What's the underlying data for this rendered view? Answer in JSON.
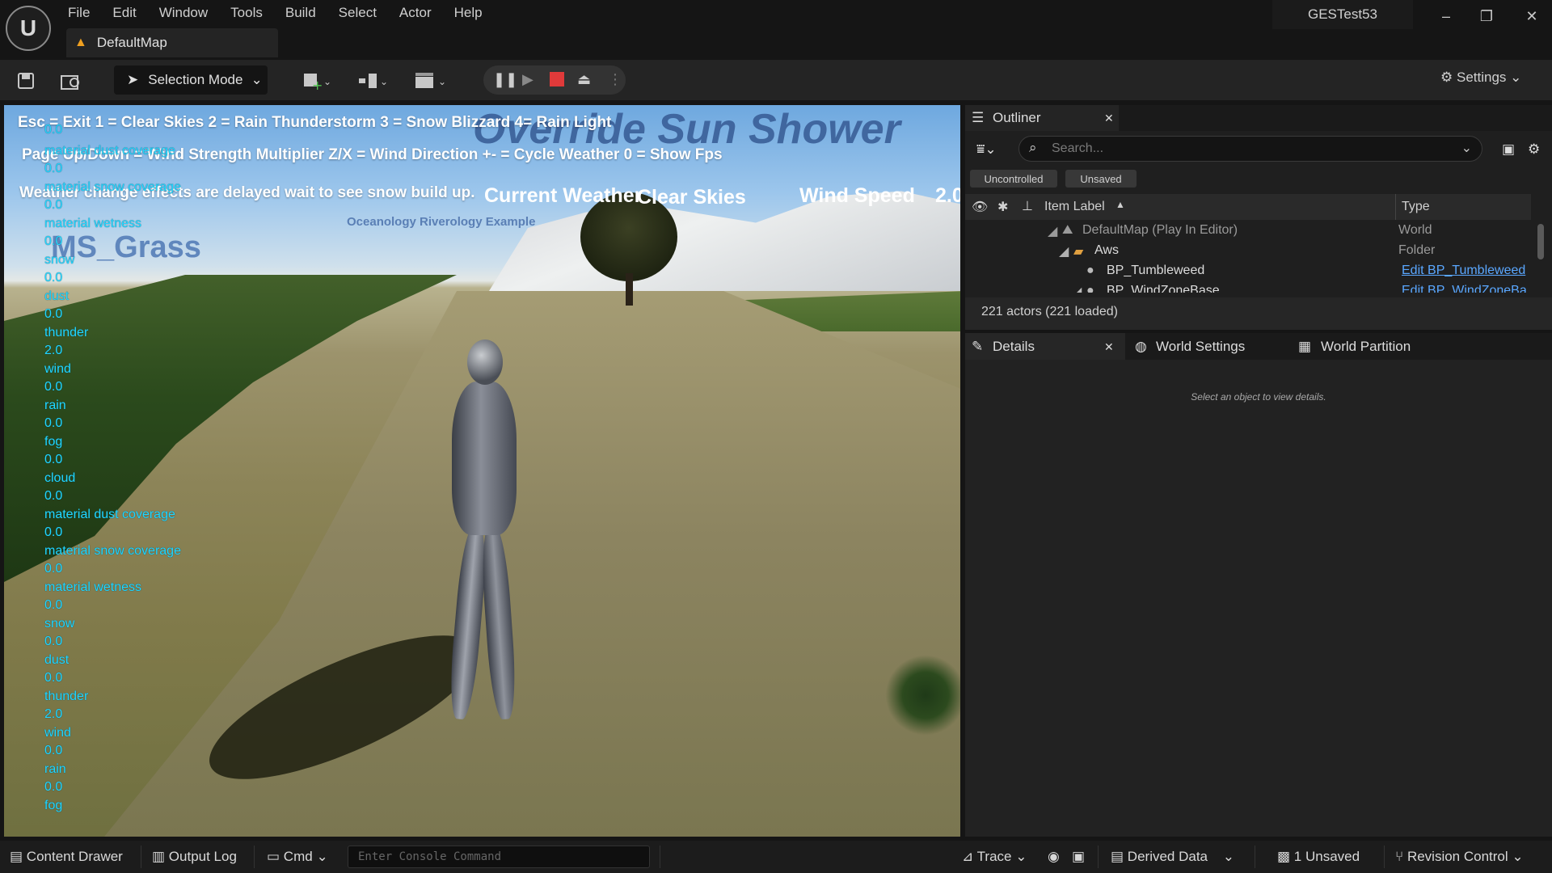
{
  "app": {
    "menu": [
      "File",
      "Edit",
      "Window",
      "Tools",
      "Build",
      "Select",
      "Actor",
      "Help"
    ],
    "doc_tab": "DefaultMap",
    "project": "GESTest53",
    "window_controls": {
      "minimize": "–",
      "restore": "❐",
      "close": "✕"
    }
  },
  "toolbar": {
    "selection_mode": "Selection Mode",
    "settings": "Settings"
  },
  "viewport": {
    "controls_line1": "Esc = Exit 1 = Clear Skies 2 = Rain Thunderstorm 3 = Snow Blizzard 4= Rain Light",
    "controls_line2": "Page Up/Down = Wind Strength Multiplier  Z/X = Wind Direction  +- = Cycle Weather  0 = Show Fps",
    "controls_line3": "Weather change effects are delayed wait to see snow build up.",
    "override_title": "Override Sun Shower",
    "current_weather_label": "Current Weather",
    "current_weather_value": "Clear Skies",
    "wind_speed_label": "Wind Speed",
    "wind_speed_value": "2.0",
    "example_name": "Oceanology Riverology Example",
    "grass_label": "MS_Grass",
    "debug_first": "0.0",
    "debug_lines": [
      "material dust coverage",
      "0.0",
      "material snow coverage",
      "0.0",
      "material wetness",
      "0.0",
      "snow",
      "0.0",
      "dust",
      "0.0",
      "thunder",
      "2.0",
      "wind",
      "0.0",
      "rain",
      "0.0",
      "fog",
      "0.0",
      "cloud",
      "0.0",
      "material dust coverage",
      "0.0",
      "material snow coverage",
      "0.0",
      "material wetness",
      "0.0",
      "snow",
      "0.0",
      "dust",
      "0.0",
      "thunder",
      "2.0",
      "wind",
      "0.0",
      "rain",
      "0.0",
      "fog"
    ]
  },
  "outliner": {
    "title": "Outliner",
    "search_placeholder": "Search...",
    "chips": [
      "Uncontrolled",
      "Unsaved"
    ],
    "col_label": "Item Label",
    "col_type": "Type",
    "rows": [
      {
        "label": "DefaultMap (Play In Editor)",
        "type": "World"
      },
      {
        "label": "Aws",
        "type": "Folder"
      },
      {
        "label": "BP_Tumbleweed",
        "type": "Edit BP_Tumbleweed"
      },
      {
        "label": "BP_WindZoneBase",
        "type": "Edit BP_WindZoneBa"
      }
    ],
    "actor_count": "221 actors (221 loaded)"
  },
  "details": {
    "tabs": [
      "Details",
      "World Settings",
      "World Partition"
    ],
    "empty_message": "Select an object to view details."
  },
  "statusbar": {
    "content_drawer": "Content Drawer",
    "output_log": "Output Log",
    "cmd": "Cmd",
    "console_placeholder": "Enter Console Command",
    "trace": "Trace",
    "derived_data": "Derived Data",
    "unsaved": "1 Unsaved",
    "revision_control": "Revision Control"
  },
  "colors": {
    "accent": "#f0a020",
    "debug_text": "#21d7ff",
    "link": "#5aa7ff",
    "stop": "#e03a3a"
  }
}
